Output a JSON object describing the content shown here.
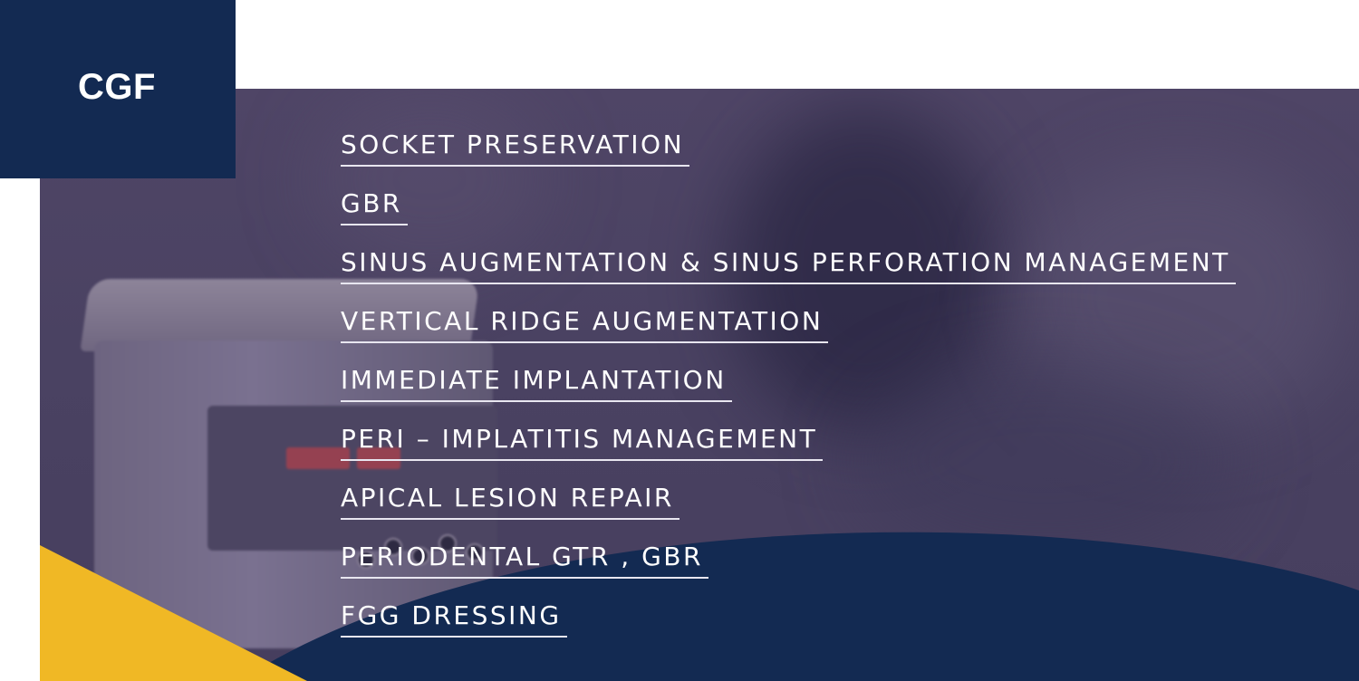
{
  "brand": {
    "title": "CGF"
  },
  "menu": {
    "items": [
      {
        "label": "SOCKET PRESERVATION"
      },
      {
        "label": "GBR"
      },
      {
        "label": "SINUS AUGMENTATION & SINUS PERFORATION MANAGEMENT"
      },
      {
        "label": "VERTICAL RIDGE AUGMENTATION"
      },
      {
        "label": "IMMEDIATE IMPLANTATION"
      },
      {
        "label": "PERI – IMPLATITIS MANAGEMENT"
      },
      {
        "label": "APICAL LESION REPAIR"
      },
      {
        "label": "PERIODENTAL GTR , GBR"
      },
      {
        "label": "FGG DRESSING"
      }
    ]
  },
  "colors": {
    "navy": "#132a52",
    "overlay": "#4a4262",
    "accent_yellow": "#f0b825",
    "text": "#ffffff"
  }
}
